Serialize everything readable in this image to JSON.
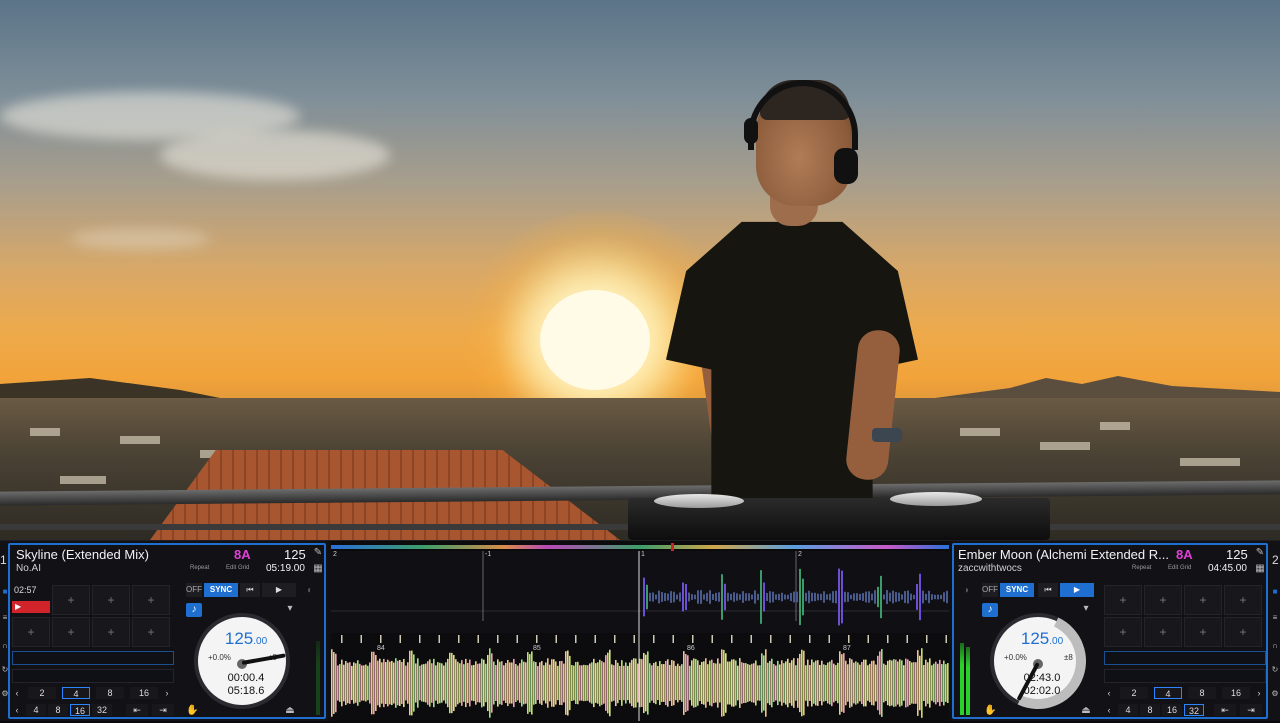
{
  "deck_left": {
    "number": "1",
    "title": "Skyline (Extended Mix)",
    "artist": "No.AI",
    "key": "8A",
    "bpm": "125",
    "repeat_label": "Repeat",
    "edit_grid_label": "Edit Grid",
    "time_remaining": "05:19.00",
    "elapsed": "02:57",
    "pads": [
      "+",
      "+",
      "+",
      "+",
      "+",
      "+",
      "+",
      "+"
    ],
    "sync_off": "OFF",
    "sync": "SYNC",
    "jog": {
      "bpm_main": "125",
      "bpm_dec": ".00",
      "pitch": "+0.0%",
      "range": "±8",
      "elapsed": "00:00.4",
      "remaining": "05:18.6"
    },
    "loop_sizes_top": [
      "2",
      "4",
      "8",
      "16"
    ],
    "loop_sizes_bottom": [
      "4",
      "8",
      "16",
      "32"
    ],
    "active_top": "4",
    "active_bottom": "16"
  },
  "deck_right": {
    "number": "2",
    "title": "Ember Moon (Alchemi Extended R...",
    "artist": "zaccwithtwocs",
    "key": "8A",
    "bpm": "125",
    "repeat_label": "Repeat",
    "edit_grid_label": "Edit Grid",
    "time_remaining": "04:45.00",
    "pads": [
      "+",
      "+",
      "+",
      "+",
      "+",
      "+",
      "+",
      "+"
    ],
    "sync_off": "OFF",
    "sync": "SYNC",
    "jog": {
      "bpm_main": "125",
      "bpm_dec": ".00",
      "pitch": "+0.0%",
      "range": "±8",
      "elapsed": "02:43.0",
      "remaining": "02:02.0"
    },
    "loop_sizes_top": [
      "2",
      "4",
      "8",
      "16"
    ],
    "loop_sizes_bottom": [
      "4",
      "8",
      "16",
      "32"
    ],
    "active_top": "4",
    "active_bottom": "32"
  },
  "waveform": {
    "top_beats": [
      "2",
      "-1",
      "1",
      "2"
    ],
    "bottom_beats": [
      "84",
      "85",
      "86",
      "87"
    ]
  },
  "colors": {
    "accent": "#1e6fd0",
    "key": "#e040d8",
    "red": "#d0242a",
    "vu_green": "#2bd12b"
  }
}
